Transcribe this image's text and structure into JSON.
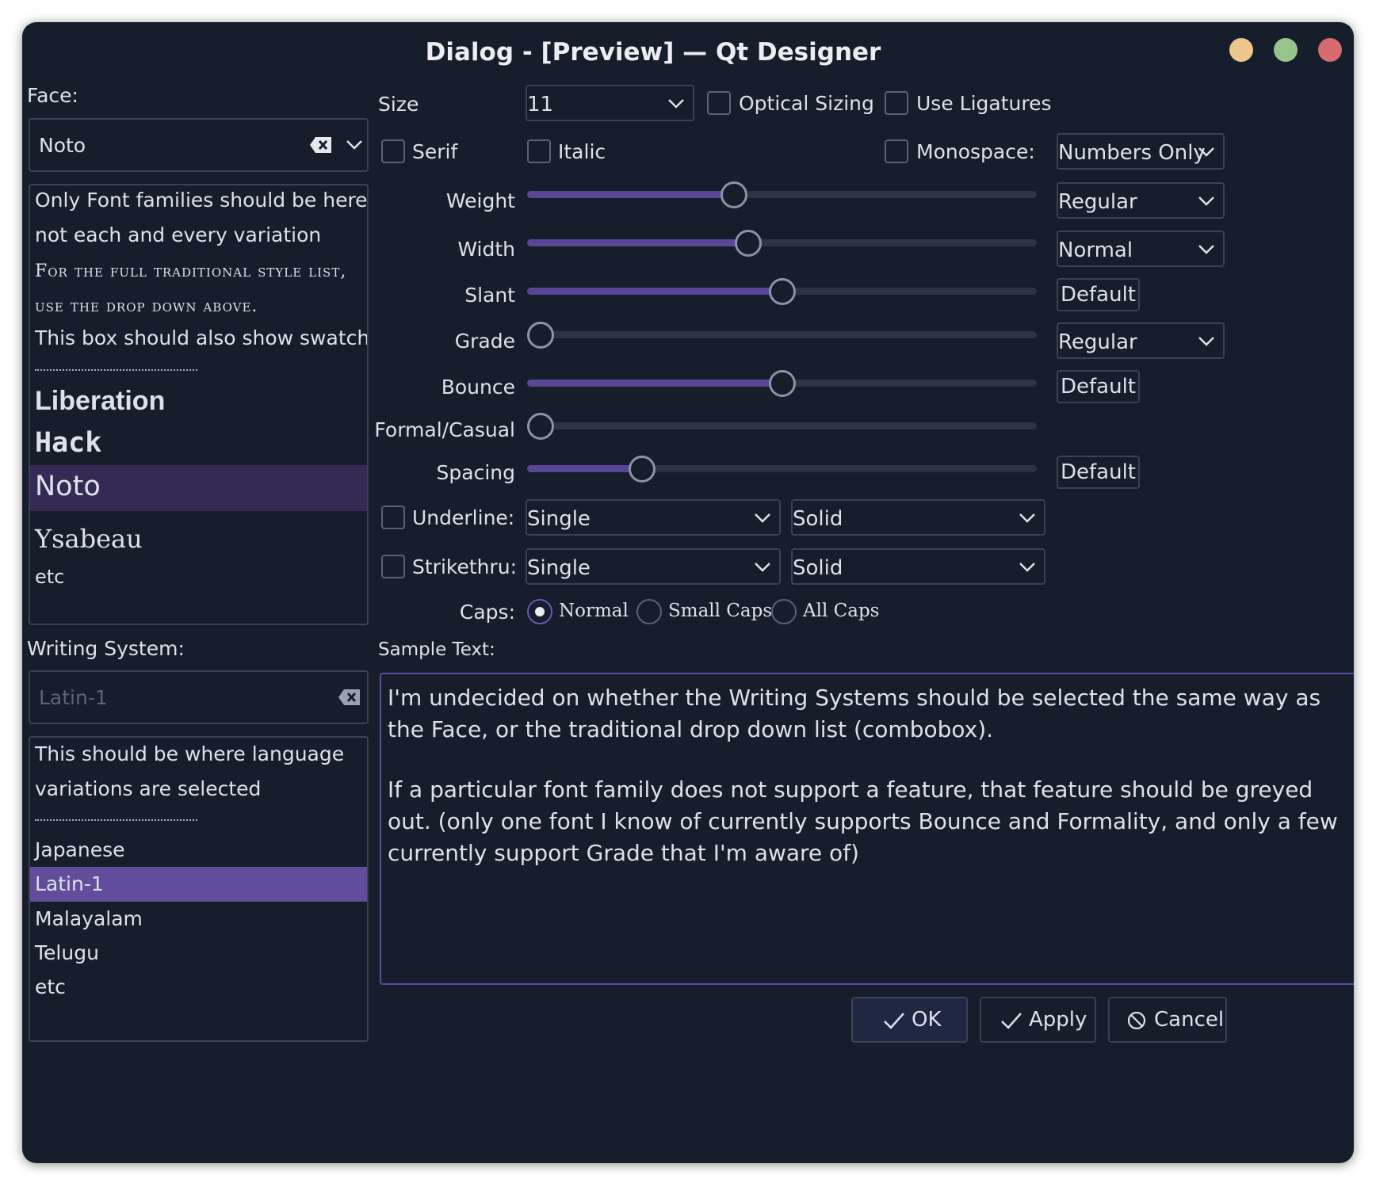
{
  "window": {
    "title": "Dialog - [Preview] — Qt Designer",
    "controls": {
      "minimize": "minimize-dot",
      "maximize": "maximize-dot",
      "close": "close-dot"
    }
  },
  "face": {
    "label": "Face:",
    "value": "Noto",
    "list_notes": [
      "Only Font families should be here,",
      "not each and every variation",
      "For the full traditional style list,",
      "use the drop down above.",
      "This box should also show swatches"
    ],
    "families": [
      "Liberation",
      "Hack",
      "Noto",
      "Ysabeau",
      "etc"
    ],
    "selected": "Noto"
  },
  "writing_system": {
    "label": "Writing System:",
    "placeholder": "Latin-1",
    "list_notes": [
      "This should be where language",
      "variations are selected"
    ],
    "items": [
      "Japanese",
      "Latin-1",
      "Malayalam",
      "Telugu",
      "etc"
    ],
    "selected": "Latin-1"
  },
  "size": {
    "label": "Size",
    "value": "11"
  },
  "checks": {
    "optical_sizing": "Optical Sizing",
    "use_ligatures": "Use Ligatures",
    "serif": "Serif",
    "italic": "Italic",
    "monospace": "Monospace:"
  },
  "monospace_value": "Numbers Only",
  "sliders": [
    {
      "label": "Weight",
      "value": 0.4,
      "side": "Regular",
      "side_type": "combo"
    },
    {
      "label": "Width",
      "value": 0.43,
      "side": "Normal",
      "side_type": "combo"
    },
    {
      "label": "Slant",
      "value": 0.5,
      "side": "Default",
      "side_type": "button"
    },
    {
      "label": "Grade",
      "value": 0.0,
      "side": "Regular",
      "side_type": "combo"
    },
    {
      "label": "Bounce",
      "value": 0.5,
      "side": "Default",
      "side_type": "button"
    },
    {
      "label": "Formal/Casual",
      "value": 0.0,
      "side": "",
      "side_type": "none"
    },
    {
      "label": "Spacing",
      "value": 0.21,
      "side": "Default",
      "side_type": "button"
    }
  ],
  "underline": {
    "label": "Underline:",
    "style": "Single",
    "line": "Solid"
  },
  "strikethru": {
    "label": "Strikethru:",
    "style": "Single",
    "line": "Solid"
  },
  "caps": {
    "label": "Caps:",
    "options": [
      "Normal",
      "Small Caps",
      "All Caps"
    ],
    "selected": "Normal"
  },
  "sample": {
    "label": "Sample Text:",
    "para1": "I'm undecided on whether the Writing Systems should be selected the same way as the Face, or the traditional drop down list (combobox).",
    "para2": "If a particular font family does not support a feature, that feature should be greyed out.  (only one font I know of currently supports Bounce and Formality, and only a few currently support Grade that I'm aware of)"
  },
  "buttons": {
    "ok": "OK",
    "apply": "Apply",
    "cancel": "Cancel"
  },
  "colors": {
    "bg": "#161d2b",
    "accent": "#5a4696",
    "selection": "#624d9c",
    "face_selection": "#342a54"
  }
}
